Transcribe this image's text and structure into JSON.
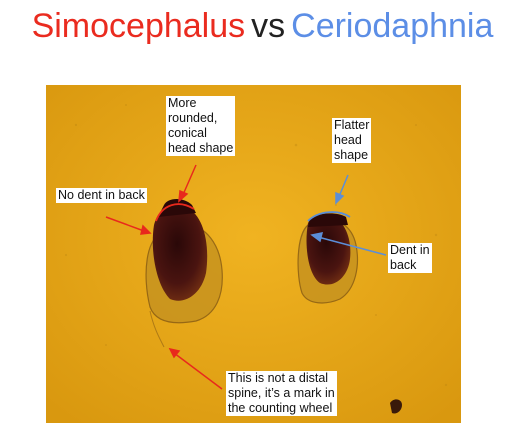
{
  "title": {
    "left": "Simocephalus",
    "vs": "vs",
    "right": "Ceriodaphnia"
  },
  "colors": {
    "red_text": "#ea2b1f",
    "blue_text": "#5c8ee6",
    "background_amber": "#e6a414",
    "specimen_dark": "#3a0e0a",
    "red_arrow": "#e8291c",
    "blue_arrow": "#5b8ed8"
  },
  "annotations": {
    "rounded_head": "More\nrounded,\nconical\nhead shape",
    "flatter_head": "Flatter\nhead\nshape",
    "no_dent": "No dent in back",
    "dent": "Dent in\nback",
    "spine_note": "This is not a distal\nspine, it’s a mark in\nthe counting wheel"
  }
}
